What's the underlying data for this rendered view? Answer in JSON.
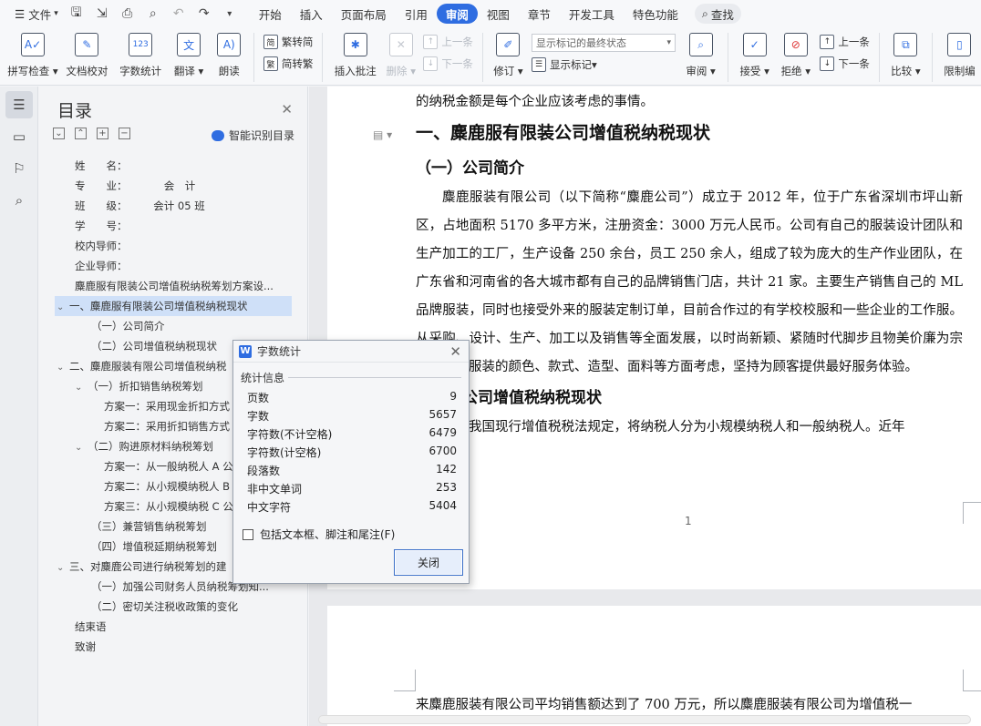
{
  "menubar": {
    "file_label": "文件",
    "tabs": [
      "开始",
      "插入",
      "页面布局",
      "引用",
      "审阅",
      "视图",
      "章节",
      "开发工具",
      "特色功能"
    ],
    "active_tab": "审阅",
    "search_label": "查找"
  },
  "ribbon": {
    "spell_check": "拼写检查",
    "doc_proof": "文档校对",
    "word_count": "字数统计",
    "translate": "翻译",
    "read_aloud": "朗读",
    "trad_to_simp": "繁转简",
    "simp_to_trad": "简转繁",
    "insert_comment": "插入批注",
    "delete": "删除",
    "prev_comment": "上一条",
    "next_comment": "下一条",
    "revise": "修订",
    "markup_select": "显示标记的最终状态",
    "show_markup": "显示标记",
    "review": "审阅",
    "accept": "接受",
    "reject": "拒绝",
    "prev_change": "上一条",
    "next_change": "下一条",
    "compare": "比较",
    "restrict_edit": "限制编"
  },
  "toc": {
    "title": "目录",
    "smart_label": "智能识别目录",
    "items": [
      {
        "text": "姓　　名：",
        "level": 0,
        "caret": ""
      },
      {
        "text": "专　　业：　　　　会　计",
        "level": 0,
        "caret": ""
      },
      {
        "text": "班　　级：　　　会计 05 班",
        "level": 0,
        "caret": ""
      },
      {
        "text": "学　　号：",
        "level": 0,
        "caret": ""
      },
      {
        "text": "校内导师：",
        "level": 0,
        "caret": ""
      },
      {
        "text": "企业导师：",
        "level": 0,
        "caret": ""
      },
      {
        "text": "麋鹿服有限装公司增值税纳税筹划方案设...",
        "level": 0,
        "caret": ""
      },
      {
        "text": "一、麋鹿服有限装公司增值税纳税现状",
        "level": 0,
        "caret": "v",
        "selected": true
      },
      {
        "text": "（一）公司简介",
        "level": 1,
        "caret": ""
      },
      {
        "text": "（二）公司增值税纳税现状",
        "level": 1,
        "caret": ""
      },
      {
        "text": "二、麋鹿服装有限公司增值税纳税",
        "level": 0,
        "caret": "v"
      },
      {
        "text": "（一）折扣销售纳税筹划",
        "level": 1,
        "caret": "v"
      },
      {
        "text": "方案一：采用现金折扣方式",
        "level": 2,
        "caret": ""
      },
      {
        "text": "方案二：采用折扣销售方式",
        "level": 2,
        "caret": ""
      },
      {
        "text": "（二）购进原材料纳税筹划",
        "level": 1,
        "caret": "v"
      },
      {
        "text": "方案一：从一般纳税人 A 公",
        "level": 2,
        "caret": ""
      },
      {
        "text": "方案二：从小规模纳税人 B",
        "level": 2,
        "caret": ""
      },
      {
        "text": "方案三：从小规模纳税 C 公",
        "level": 2,
        "caret": ""
      },
      {
        "text": "（三）兼营销售纳税筹划",
        "level": 1,
        "caret": ""
      },
      {
        "text": "（四）增值税延期纳税筹划",
        "level": 1,
        "caret": ""
      },
      {
        "text": "三、对麋鹿公司进行纳税筹划的建",
        "level": 0,
        "caret": "v"
      },
      {
        "text": "（一）加强公司财务人员纳税筹划知...",
        "level": 1,
        "caret": ""
      },
      {
        "text": "（二）密切关注税收政策的变化",
        "level": 1,
        "caret": ""
      },
      {
        "text": "结束语",
        "level": 0,
        "caret": ""
      },
      {
        "text": "致谢",
        "level": 0,
        "caret": ""
      }
    ]
  },
  "document": {
    "line_top": "的纳税金额是每个企业应该考虑的事情。",
    "heading1": "一、麋鹿服有限装公司增值税纳税现状",
    "heading2": "（一）公司简介",
    "paragraph": "麋鹿服装有限公司（以下简称“麋鹿公司”）成立于 2012 年，位于广东省深圳市坪山新区，占地面积 5170 多平方米，注册资金：3000 万元人民币。公司有自己的服装设计团队和生产加工的工厂，生产设备 250 余台，员工 250 余人，组成了较为庞大的生产作业团队，在广东省和河南省的各大城市都有自己的品牌销售门店，共计 21 家。主要生产销售自己的 ML 品牌服装，同时也接受外来的服装定制订单，目前合作过的有学校校服和一些企业的工作服。从采购、设计、生产、加工以及销售等全面发展，以时尚新颖、紧随时代脚步且物美价廉为宗旨，并从服装的颜色、款式、造型、面料等方面考虑，坚持为顾客提供最好服务体验。",
    "heading3": "（二）公司增值税纳税现状",
    "paragraph2": "根据我国现行增值税税法规定，将纳税人分为小规模纳税人和一般纳税人。近年",
    "page_number": "1",
    "page2_line": "来麋鹿服装有限公司平均销售额达到了 700 万元，所以麋鹿服装有限公司为增值税一"
  },
  "dialog": {
    "title": "字数统计",
    "group_label": "统计信息",
    "stats": [
      {
        "label": "页数",
        "value": "9"
      },
      {
        "label": "字数",
        "value": "5657"
      },
      {
        "label": "字符数(不计空格)",
        "value": "6479"
      },
      {
        "label": "字符数(计空格)",
        "value": "6700"
      },
      {
        "label": "段落数",
        "value": "142"
      },
      {
        "label": "非中文单词",
        "value": "253"
      },
      {
        "label": "中文字符",
        "value": "5404"
      }
    ],
    "checkbox_label": "包括文本框、脚注和尾注(F)",
    "close_button": "关闭"
  }
}
